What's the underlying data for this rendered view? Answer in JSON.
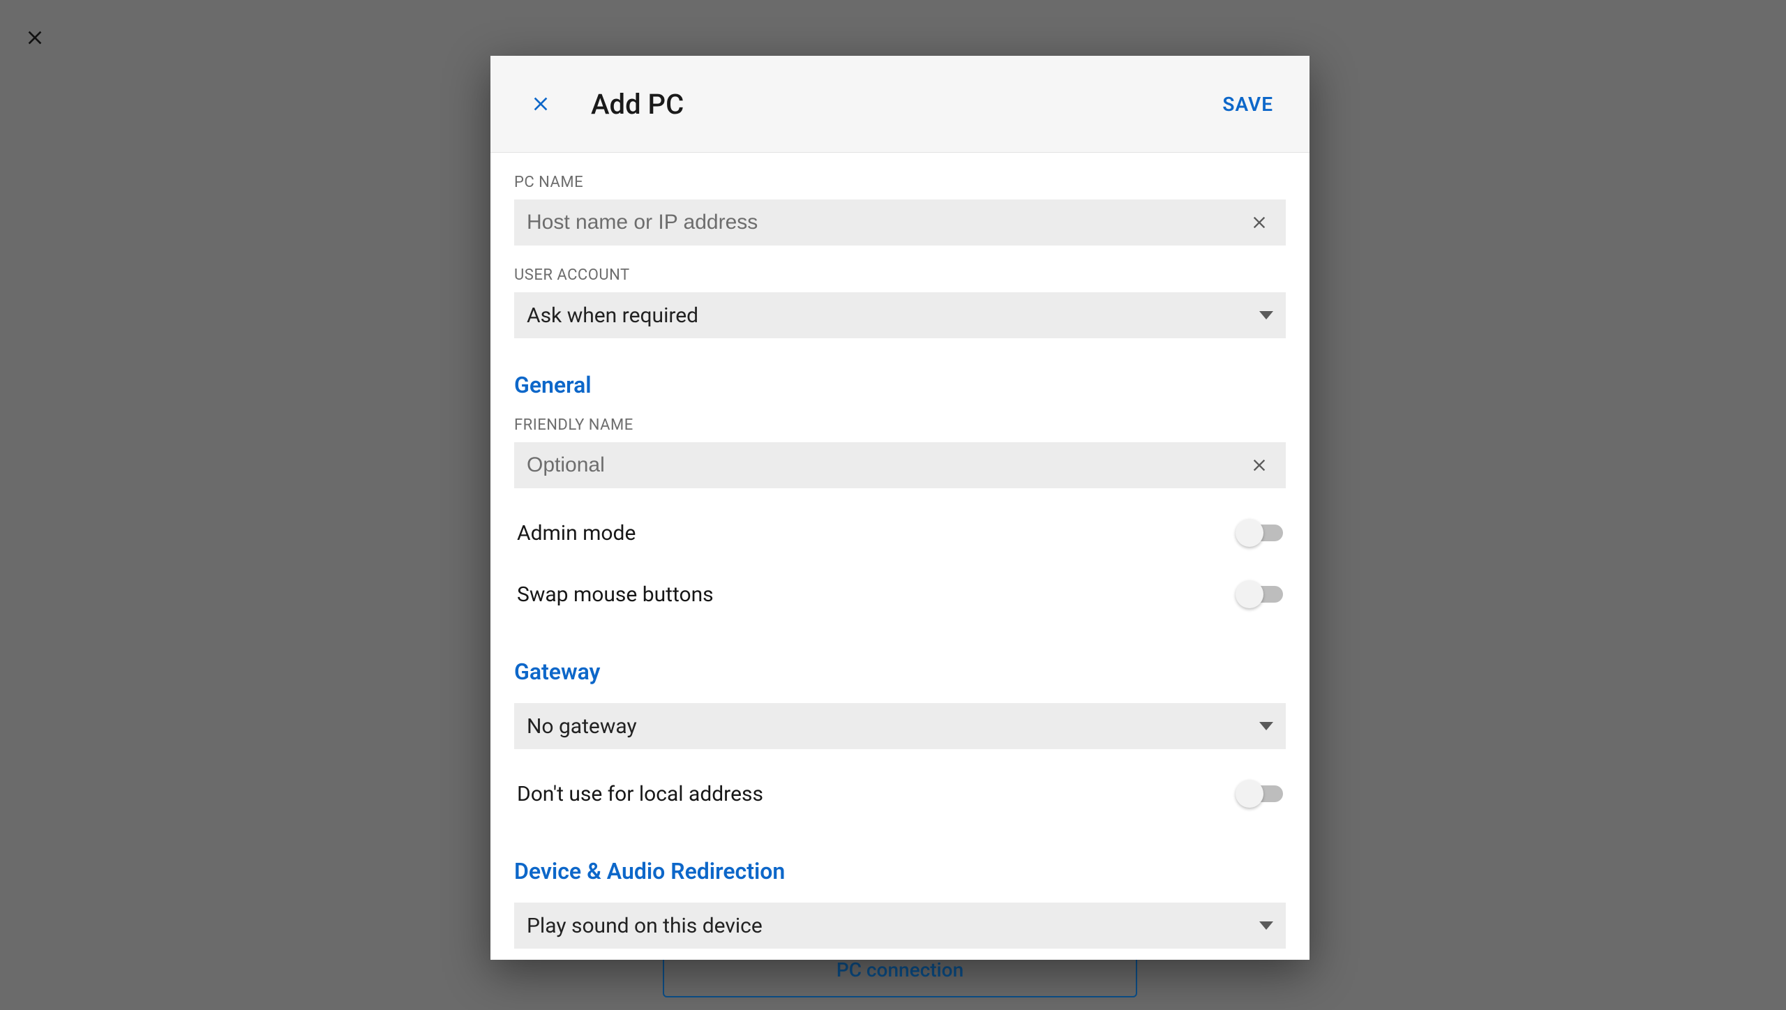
{
  "backdrop": {
    "pc_connection_label": "PC connection"
  },
  "dialog": {
    "title": "Add PC",
    "save_label": "SAVE",
    "pc_name": {
      "label": "PC NAME",
      "placeholder": "Host name or IP address",
      "value": ""
    },
    "user_account": {
      "label": "USER ACCOUNT",
      "selected": "Ask when required"
    },
    "sections": {
      "general": {
        "title": "General",
        "friendly_name": {
          "label": "FRIENDLY NAME",
          "placeholder": "Optional",
          "value": ""
        },
        "admin_mode": {
          "label": "Admin mode",
          "on": false
        },
        "swap_mouse": {
          "label": "Swap mouse buttons",
          "on": false
        }
      },
      "gateway": {
        "title": "Gateway",
        "selected": "No gateway",
        "bypass_local": {
          "label": "Don't use for local address",
          "on": false
        }
      },
      "redirection": {
        "title": "Device & Audio Redirection",
        "sound_selected": "Play sound on this device"
      }
    }
  },
  "colors": {
    "accent": "#0d67c9"
  }
}
